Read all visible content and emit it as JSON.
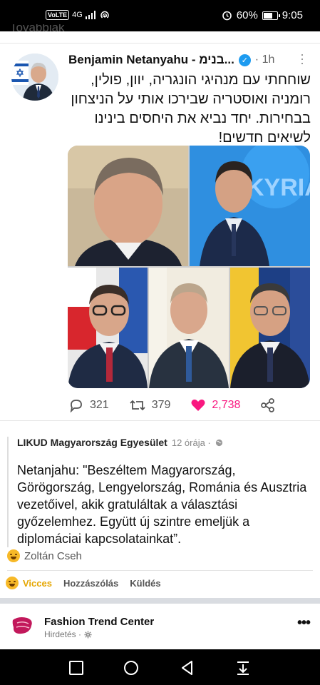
{
  "status_bar": {
    "volte": "VoLTE",
    "network": "4G",
    "battery_text": "60%",
    "battery_level": 0.6,
    "time": "9:05"
  },
  "cut_text": "Tovabbiak",
  "tweet": {
    "author": "Benjamin Netanyahu - בנימ...",
    "time": "· 1h",
    "text": "שוחחתי עם מנהיגי הונגריה, יוון, פולין, רומניה ואוסטריה שבירכו אותי על הניצחון בבחירות. יחד נביא את היחסים בינינו לשיאים חדשים!",
    "replies": "321",
    "retweets": "379",
    "likes": "2,738",
    "like_color": "#f91880"
  },
  "shared_post": {
    "page_name": "LIKUD Magyarország Egyesület",
    "time": "12 órája ·",
    "text": "Netanjahu: \"Beszéltem Magyarország, Görögország, Lengyelország, Románia és Ausztria vezetőivel, akik gratuláltak a választási győzelemhez. Együtt új szintre emeljük a diplomáciai kapcsolatainkat”."
  },
  "reactions": {
    "reactor": "Zoltán Cseh"
  },
  "fb_actions": {
    "reaction": "Vicces",
    "comment": "Hozzászólás",
    "send": "Küldés",
    "reaction_color": "#e5a600"
  },
  "ad": {
    "title": "Fashion Trend Center",
    "sub": "Hirdetés ·"
  }
}
